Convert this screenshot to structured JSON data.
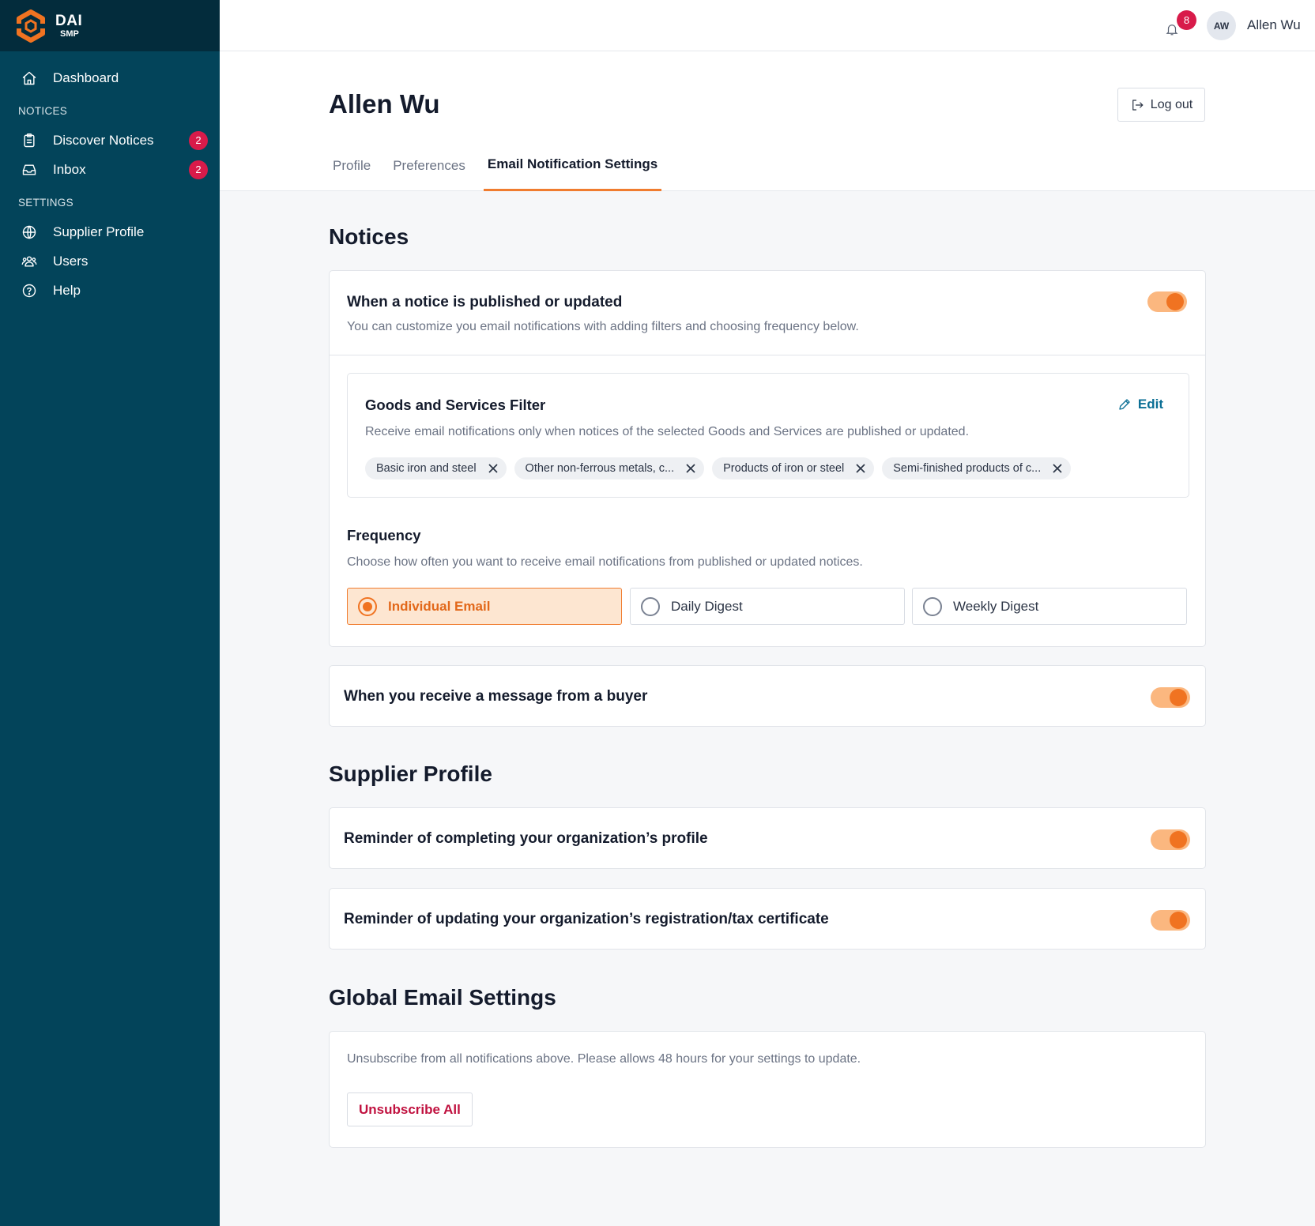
{
  "brand": {
    "name": "DAI",
    "sub": "SMP"
  },
  "sidebar": {
    "items": [
      {
        "label": "Dashboard"
      },
      {
        "section": "NOTICES"
      },
      {
        "label": "Discover Notices",
        "badge": "2"
      },
      {
        "label": "Inbox",
        "badge": "2"
      },
      {
        "section": "SETTINGS"
      },
      {
        "label": "Supplier Profile"
      },
      {
        "label": "Users"
      },
      {
        "label": "Help"
      }
    ]
  },
  "topbar": {
    "notification_count": "8",
    "avatar_initials": "AW",
    "user_name": "Allen Wu"
  },
  "header": {
    "title": "Allen Wu",
    "logout_label": "Log out",
    "tabs": [
      {
        "label": "Profile",
        "active": false
      },
      {
        "label": "Preferences",
        "active": false
      },
      {
        "label": "Email Notification Settings",
        "active": true
      }
    ]
  },
  "notices": {
    "heading": "Notices",
    "published": {
      "title": "When a notice is published or updated",
      "description": "You can customize you email notifications with adding filters and choosing frequency below.",
      "enabled": true
    },
    "filter": {
      "title": "Goods and Services Filter",
      "edit_label": "Edit",
      "description": "Receive email notifications only when notices of the selected Goods and Services are published or updated.",
      "chips": [
        "Basic iron and steel",
        "Other non-ferrous metals, c...",
        "Products of iron or steel",
        "Semi-finished products of c..."
      ]
    },
    "frequency": {
      "title": "Frequency",
      "description": "Choose how often you want to receive email notifications from published or updated notices.",
      "options": [
        "Individual Email",
        "Daily Digest",
        "Weekly Digest"
      ],
      "selected": "Individual Email"
    },
    "buyer_message": {
      "title": "When you receive a message from a buyer",
      "enabled": true
    }
  },
  "supplier_profile": {
    "heading": "Supplier Profile",
    "items": [
      {
        "title": "Reminder of completing your organization’s profile",
        "enabled": true
      },
      {
        "title": "Reminder of updating your organization’s registration/tax certificate",
        "enabled": true
      }
    ]
  },
  "global": {
    "heading": "Global Email Settings",
    "description": "Unsubscribe from all notifications above. Please allows 48 hours for your settings to update.",
    "button_label": "Unsubscribe All"
  },
  "colors": {
    "sidebar": "#03445a",
    "sidebar_top": "#032c3c",
    "accent": "#f07321",
    "badge": "#d81b4a",
    "link": "#0b6f95",
    "danger": "#c0113f"
  }
}
